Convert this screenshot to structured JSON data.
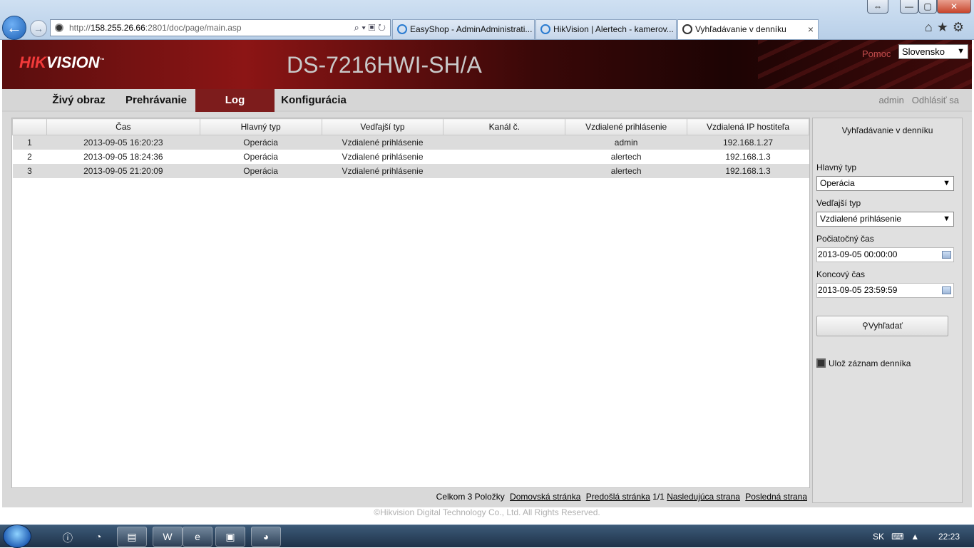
{
  "browser": {
    "url_prefix": "http://",
    "url_host": "158.255.26.66",
    "url_rest": ":2801/doc/page/main.asp",
    "tabs": [
      {
        "label": "EasyShop - AdminAdministrati..."
      },
      {
        "label": "HikVision | Alertech - kamerov..."
      },
      {
        "label": "Vyhľadávanie v denníku"
      }
    ],
    "window_buttons": {
      "restore": "⇔",
      "minimize": "—",
      "maximize": "▢",
      "close": "✕"
    }
  },
  "header": {
    "logo_hik": "HIK",
    "logo_vision": "VISION",
    "model": "DS-7216HWI-SH/A",
    "help": "Pomoc",
    "language": "Slovensko"
  },
  "menu": {
    "items": [
      "Živý obraz",
      "Prehrávanie",
      "Log",
      "Konfigurácia"
    ],
    "active": "Log",
    "user": "admin",
    "logout": "Odhlásiť sa"
  },
  "table": {
    "columns": [
      "",
      "Čas",
      "Hlavný typ",
      "Vedľajší typ",
      "Kanál č.",
      "Vzdialené prihlásenie",
      "Vzdialená IP hostiteľa"
    ],
    "rows": [
      [
        "1",
        "2013-09-05 16:20:23",
        "Operácia",
        "Vzdialené prihlásenie",
        "",
        "admin",
        "192.168.1.27"
      ],
      [
        "2",
        "2013-09-05 18:24:36",
        "Operácia",
        "Vzdialené prihlásenie",
        "",
        "alertech",
        "192.168.1.3"
      ],
      [
        "3",
        "2013-09-05 21:20:09",
        "Operácia",
        "Vzdialené prihlásenie",
        "",
        "alertech",
        "192.168.1.3"
      ]
    ]
  },
  "pager": {
    "total": "Celkom 3 Položky",
    "home": "Domovská stránka",
    "prev": "Predošlá stránka",
    "page": "1/1",
    "next": "Nasledujúca strana",
    "last": "Posledná strana"
  },
  "search": {
    "title": "Vyhľadávanie v denníku",
    "main_type_label": "Hlavný typ",
    "main_type_value": "Operácia",
    "sub_type_label": "Vedľajší typ",
    "sub_type_value": "Vzdialené prihlásenie",
    "start_label": "Počiatočný čas",
    "start_value": "2013-09-05 00:00:00",
    "end_label": "Koncový čas",
    "end_value": "2013-09-05 23:59:59",
    "button": "Vyhľadať",
    "save": "Ulož záznam denníka"
  },
  "footer": "©Hikvision Digital Technology Co., Ltd. All Rights Reserved.",
  "taskbar": {
    "lang": "SK",
    "time": "22:23"
  }
}
